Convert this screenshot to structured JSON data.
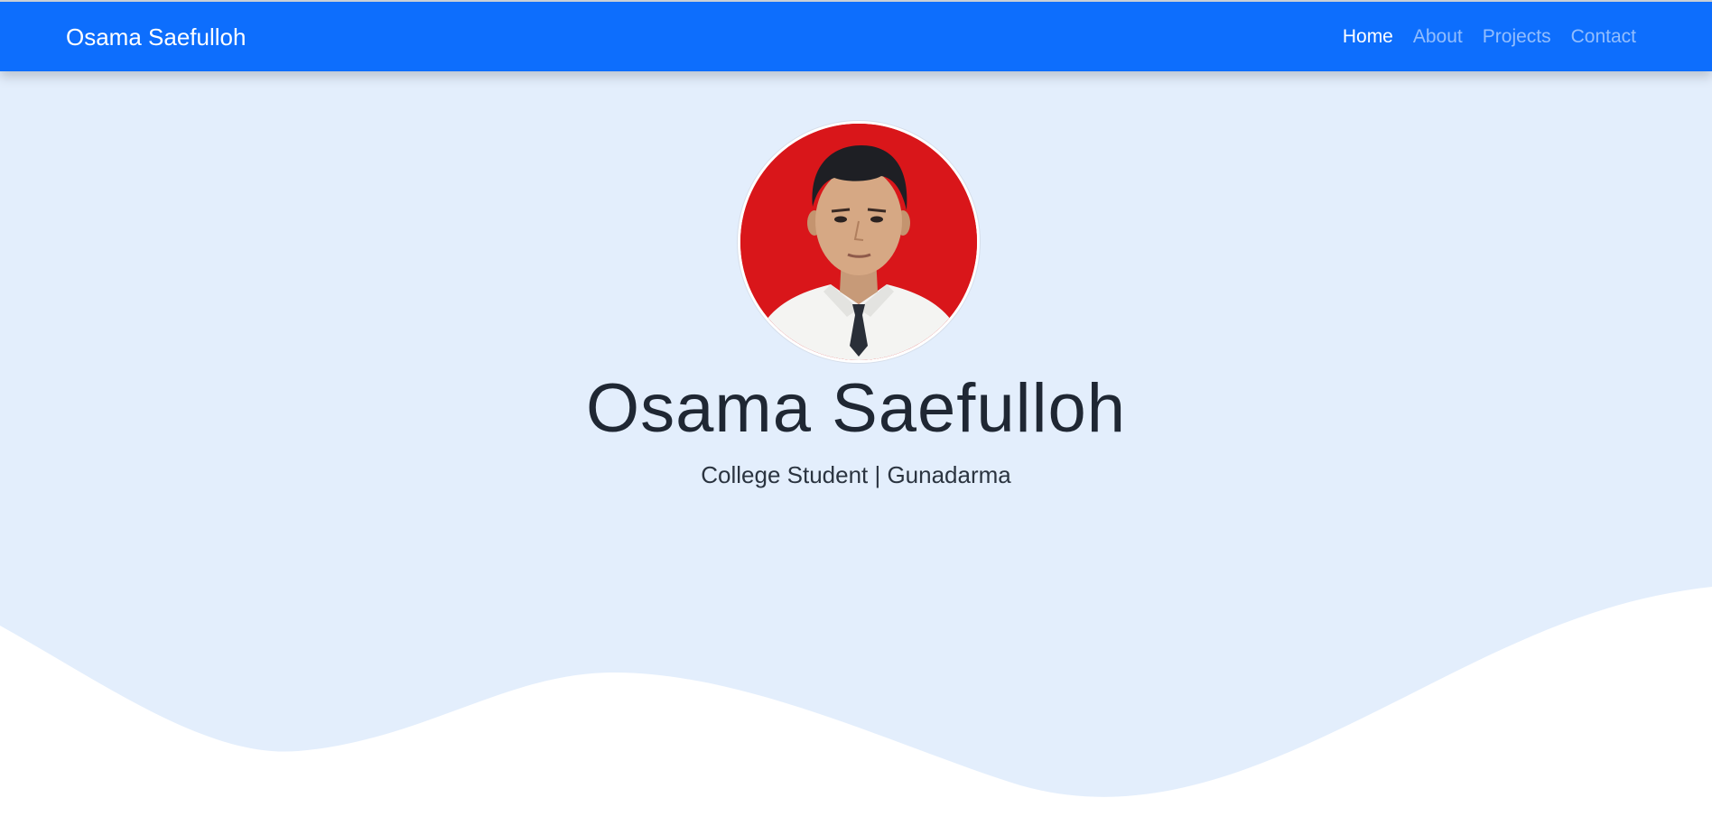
{
  "navbar": {
    "brand": "Osama Saefulloh",
    "links": [
      {
        "label": "Home",
        "active": true
      },
      {
        "label": "About",
        "active": false
      },
      {
        "label": "Projects",
        "active": false
      },
      {
        "label": "Contact",
        "active": false
      }
    ]
  },
  "hero": {
    "name": "Osama Saefulloh",
    "subtitle": "College Student | Gunadarma",
    "avatar": {
      "description": "profile-photo"
    }
  },
  "colors": {
    "navbar_bg": "#0d6efd",
    "hero_bg": "#e3eefc",
    "wave_fill": "#ffffff",
    "avatar_bg": "#d9161a"
  }
}
